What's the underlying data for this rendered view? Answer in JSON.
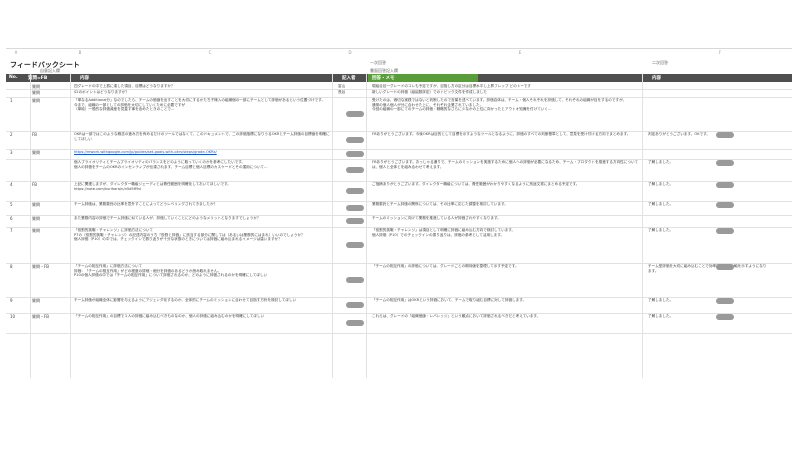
{
  "sheet": {
    "title": "フィードバックシート",
    "column_letters": [
      "A",
      "B",
      "C",
      "D",
      "E",
      "F"
    ],
    "group_headers": {
      "left": "自意記入欄",
      "middle": "一次回答",
      "middle_sub": "書面回答記入欄",
      "right": "二次回答"
    },
    "header": {
      "no": "No.",
      "kind": "質問=FB",
      "content": "内容",
      "writer": "記入者",
      "answer": "回答・メモ",
      "right_content": "内容"
    },
    "accent_color": "#5a9c3a",
    "rows": [
      {
        "no": "",
        "kind": "質問",
        "content": "四グレードの中で上振に達した項目、目標はどうなりますか？",
        "writer": "富山",
        "answer": "現組合目一グレードのコレも予定ですが、目指し方の区分は目標水平し上昇フレップ どのトーです",
        "right": ""
      },
      {
        "no": "",
        "kind": "質問",
        "content": "S2のポイントはどうなりますか？",
        "writer": "長谷",
        "answer": "新しいグレードの評価（組組数評定）でのトピック文件を作成しました",
        "right": ""
      },
      {
        "no": "1",
        "kind": "質問",
        "content": "「単なるAdditional分」なのでしたら、チームの価値を出すことを大切にするかたち子様入の組織個の一部にチームとして評価があるという位置づけです。\n今まで、組織の一部としての評価を大切にしていくために必要ですが\n（単純）一般的な評価減産を見直す事を含めたときのことで…",
        "writer": "",
        "answer": "受けたのは、適切な実践ではないと判断したので言葉を述べています。評価自体は、チーム・個人それぞれを評価して、それぞれの組織が目をするのですが。\n通常の個人個人が分に合わせた上に、それぞれ企業されていました。\n今回の組織の一部にてのチームの評価・戦略的なさらに少なかの上位に向かったとアウトオ知識を付けていく…",
        "right": ""
      },
      {
        "no": "2",
        "kind": "FB",
        "content": "OKRは一部ではこのような概念の進み方を有めるだけのツールではなくて、このドキュメントで、二の評価指標になりうるOKRとチーム評価の目標値を明確にしてほしい",
        "writer": "",
        "answer": "FBありがとうございます。今後OKRは目的として目標を示すようなツールとなるように、評価のすべての判断基準として、意見を受け付ける方向でまとめます。",
        "right": "判定ありがとうございます。OKです。"
      },
      {
        "no": "3",
        "kind": "質問",
        "content": "https://rework.withgoogle.com/jp/guides/set-goals-with-okrs/steps/grade-OKRs/",
        "writer": "",
        "answer": "",
        "right": ""
      },
      {
        "no": "",
        "kind": "",
        "content": "個人プライオリティとチームプライオリティのバランスをどのように取っていくのかを参考にしたいです。\n個人の評価をチームのOKRのインセンティブが伝達されます、チーム目標と個人目標のカスケードとその運用について…",
        "writer": "",
        "answer": "FBありがとうございます。おっしゃる通りで、チームのミッションを実施するために個人への評価が必要になるため、チーム・プロダクトを推進する方向性については、個人と全体とを組み合わせて考えます。",
        "right": "了解しました。"
      },
      {
        "no": "4",
        "kind": "FB",
        "content": "上記に関連しますが、ダイレクター職級ジェーディとは責任範囲を明確化しておいてほしいです。\nhttps://note.com/kurihara/n/n5d5ff9d",
        "writer": "",
        "answer": "ご指摘ありがとうございます。ダイレクター職級については、責任範囲がわかりやすくなるように別途文書にまとめる予定です。",
        "right": "了解しました。"
      },
      {
        "no": "5",
        "kind": "質問",
        "content": "チーム評価は、業務委託の比率を意外すことによってどうレベリングされてきましたか？",
        "writer": "",
        "answer": "業務委託とチーム評価の関係については、その比率に応じた調整を検討しています。",
        "right": "了解しました。"
      },
      {
        "no": "6",
        "kind": "質問",
        "content": "また業務内容の評価でチーム評価に似ている人が、評価していくことにどのようなメリットとなりますでしょうか？",
        "writer": "",
        "answer": "チームのミッションに向けて業務を推進している人が評価されやすくなります。",
        "right": ""
      },
      {
        "no": "7",
        "kind": "質問",
        "content": "「役割的挑戦・チャレンジ」に評価方法について\nP7の（役割的挑戦・チャレンジ）の記述内容のうち「役割と評価」に該当する部分に関しては（あるいは業務的にはまれ）いいのでしょうか？\n個人評価（P10）の中では、チェックインで振り返りが十分な状態のときについては評価に組み込まれるイメージは違いますか？",
        "writer": "",
        "answer": "「役割的挑戦・チャレンジ」は項目として明確に評価に組み込む方向で検討しています。\n個人評価（P10）でのチェックインの振り返りは、評価の参考として活用します。",
        "right": "了解しました。"
      },
      {
        "no": "8",
        "kind": "質問・FB",
        "content": "「チームの相互作用」に評価方法について\n評価：「チームの相互作用」がどの程度の詳細・細分を評価のあるどうか読み取れません。\nP10の個人評価の中では「チームの相互作用」について評価されるのか、どのように評価されるのかを明確にしてほしい",
        "writer": "",
        "answer": "「チームの相互作用」の評価については、グレードごとの期待値を整理して示す予定です。",
        "right": "チーム型評価を大切に組み込むことで効率的に評価の軸を示すようになります。"
      },
      {
        "no": "9",
        "kind": "質問",
        "content": "チーム評価が組織全体に影響を与えるようにアジェンダ化するのか、全体的にチームのミッションに合わせて目指す方針を検討してほしい",
        "writer": "",
        "answer": "「チームの相互作用」はOKRという評価において、チームで取り組む目標に対して評価します。",
        "right": "了解しました。"
      },
      {
        "no": "10",
        "kind": "質問・FB",
        "content": "「チームの相互作用」の目標で１人の評価に組み込むべきものなのか、個人の評価に組み込むのかを明確にしてほしい",
        "writer": "",
        "answer": "これらは、グレードの「組織価値・レバレッジ」という観点において評価されるべきだと考えています。",
        "right": "了解しました。"
      }
    ]
  }
}
